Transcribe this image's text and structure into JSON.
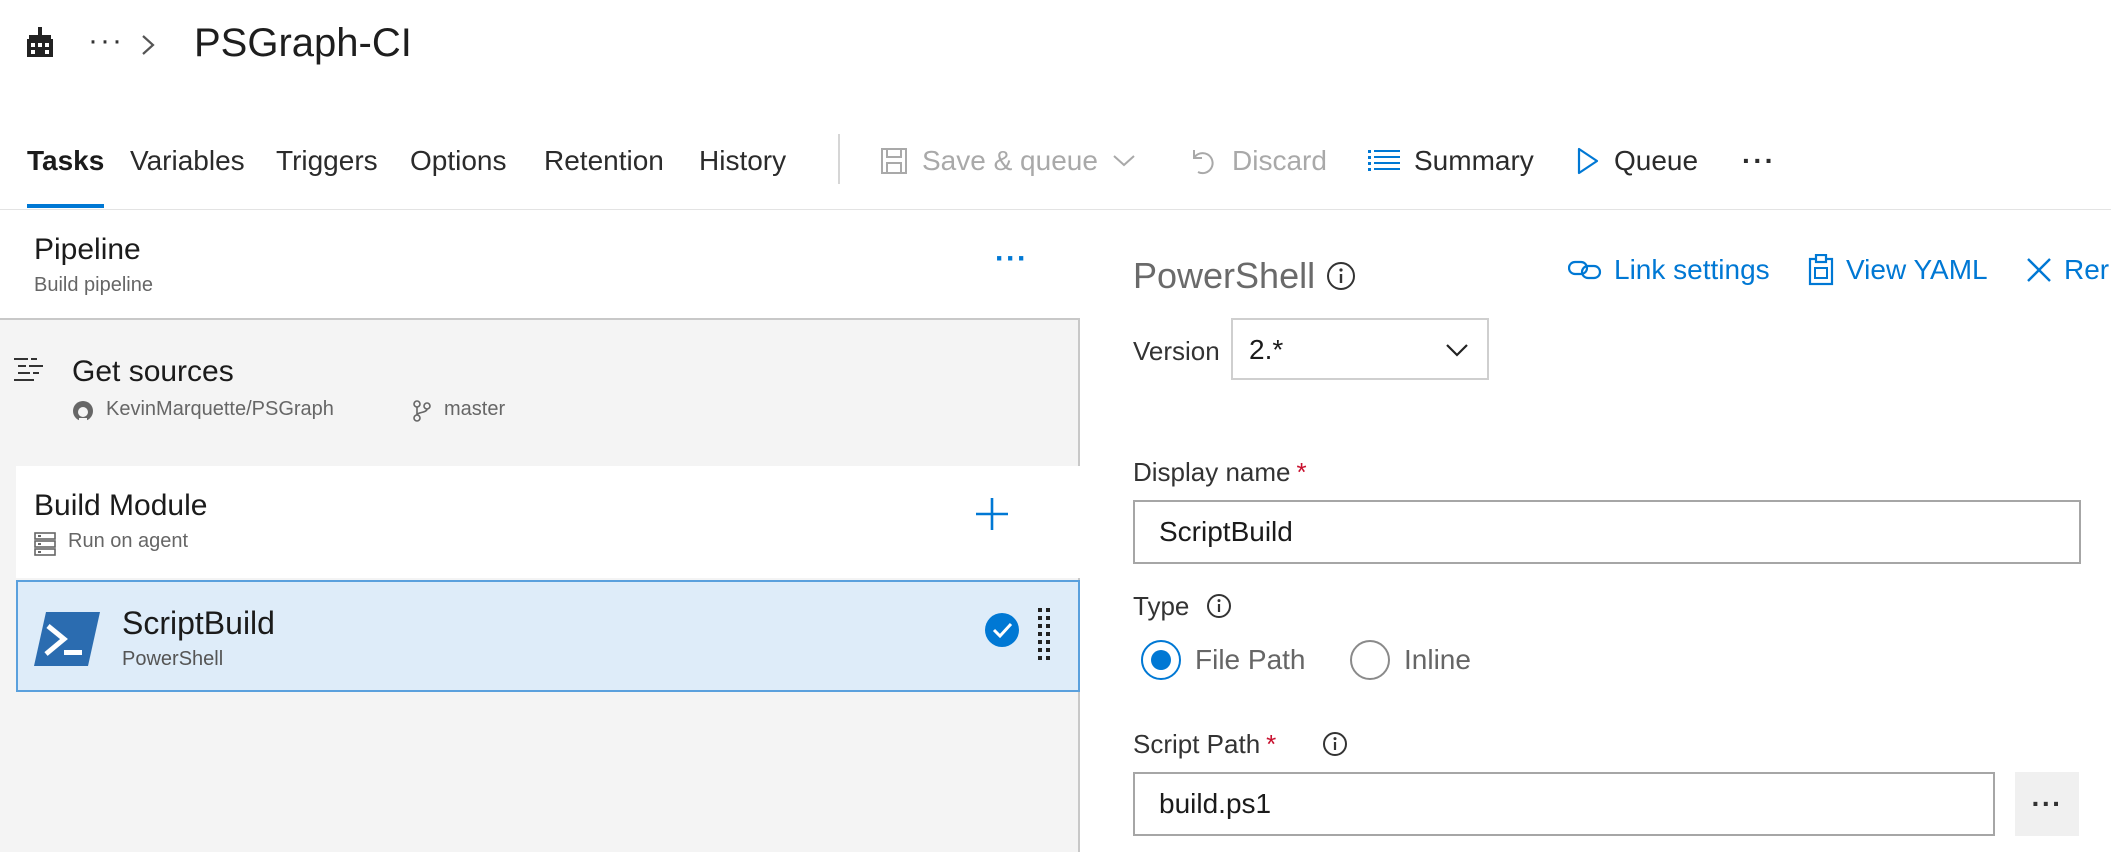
{
  "header": {
    "more_label": "···",
    "title": "PSGraph-CI"
  },
  "tabs": [
    {
      "label": "Tasks",
      "active": true
    },
    {
      "label": "Variables"
    },
    {
      "label": "Triggers"
    },
    {
      "label": "Options"
    },
    {
      "label": "Retention"
    },
    {
      "label": "History"
    }
  ],
  "commands": {
    "save_queue": "Save & queue",
    "discard": "Discard",
    "summary": "Summary",
    "queue": "Queue",
    "more": "···"
  },
  "pipeline": {
    "title": "Pipeline",
    "subtitle": "Build pipeline",
    "more": "···"
  },
  "sources": {
    "title": "Get sources",
    "repo": "KevinMarquette/PSGraph",
    "branch": "master"
  },
  "phase": {
    "title": "Build Module",
    "subtitle": "Run on agent"
  },
  "task": {
    "title": "ScriptBuild",
    "subtitle": "PowerShell"
  },
  "details": {
    "task_name": "PowerShell",
    "link_settings": "Link settings",
    "view_yaml": "View YAML",
    "remove": "Rer",
    "version_label": "Version",
    "version_value": "2.*",
    "display_name_label": "Display name",
    "display_name_value": "ScriptBuild",
    "required_mark": "*",
    "type_label": "Type",
    "type_options": [
      "File Path",
      "Inline"
    ],
    "type_selected": "File Path",
    "script_path_label": "Script Path",
    "script_path_value": "build.ps1",
    "browse": "···"
  },
  "colors": {
    "accent": "#0078d4",
    "selected_row": "#deecf9",
    "required": "#c8102e",
    "powershell": "#2b6cb0"
  }
}
